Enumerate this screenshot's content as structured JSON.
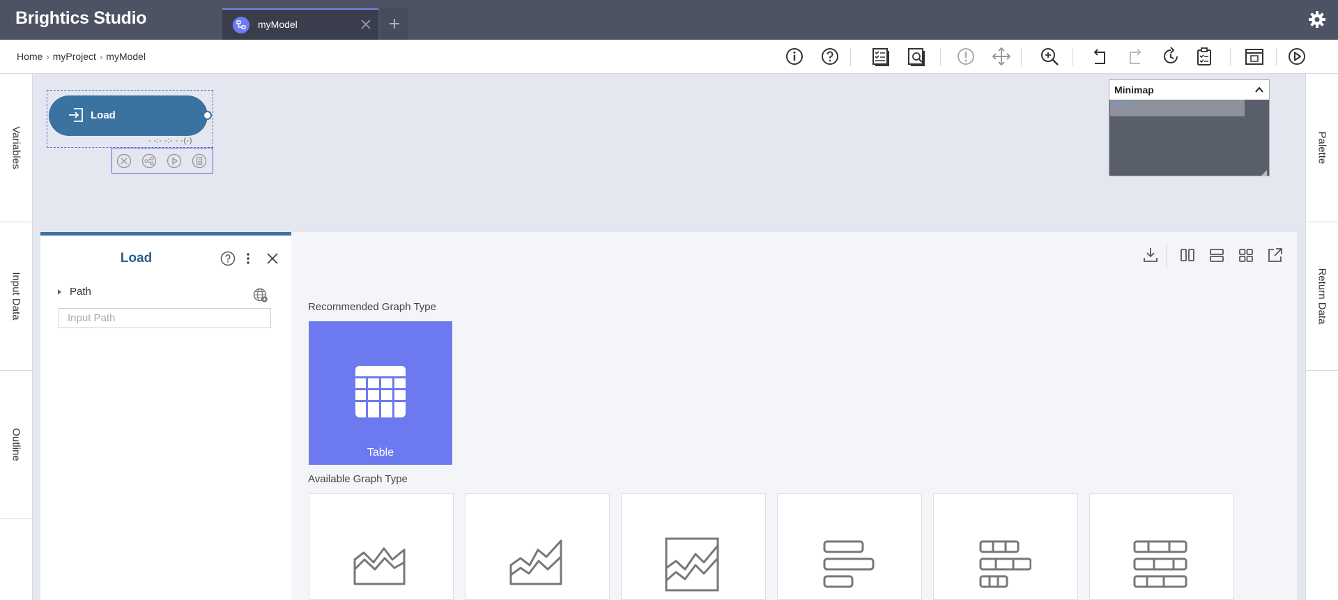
{
  "app": {
    "brand": "Brightics Studio",
    "settings_icon": "gear-icon"
  },
  "tabs": [
    {
      "label": "myModel",
      "icon": "model-icon",
      "active": true
    }
  ],
  "breadcrumb": [
    "Home",
    "myProject",
    "myModel"
  ],
  "toolbar": {
    "icons": [
      "info-icon",
      "help-icon",
      "model-checklist-icon",
      "model-search-icon",
      "validation-icon",
      "move-icon",
      "zoom-icon",
      "undo-icon",
      "redo-icon",
      "history-icon",
      "clipboard-icon",
      "report-icon",
      "run-icon"
    ]
  },
  "rails": {
    "left": [
      "Variables",
      "Input Data",
      "Outline"
    ],
    "right": [
      "Palette",
      "Return Data"
    ]
  },
  "canvas": {
    "node": {
      "label": "Load",
      "status": "- -:- -:- - -(-)"
    },
    "node_actions": [
      "delete-icon",
      "share-icon",
      "run-icon",
      "clipboard-icon"
    ]
  },
  "minimap": {
    "title": "Minimap"
  },
  "panel": {
    "title": "Load",
    "path_label": "Path",
    "path_value": "",
    "path_placeholder": "Input Path"
  },
  "graph": {
    "recommended_label": "Recommended Graph Type",
    "recommended": {
      "label": "Table",
      "icon": "table-icon"
    },
    "available_label": "Available Graph Type",
    "available_icons": [
      "area-chart-icon",
      "stacked-area-chart-icon",
      "area-chart-framed-icon",
      "bar-chart-icon",
      "stacked-bar-chart-icon",
      "stacked-bar-100-chart-icon"
    ],
    "tool_icons": [
      "download-icon",
      "split-vertical-icon",
      "split-horizontal-icon",
      "grid-icon",
      "popout-icon"
    ]
  },
  "colors": {
    "topbar": "#4e5364",
    "accent": "#6d7aef",
    "node": "#3a72a0"
  }
}
